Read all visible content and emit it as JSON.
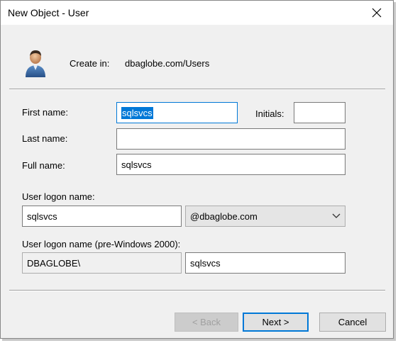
{
  "window": {
    "title": "New Object - User"
  },
  "icons": {
    "close": "close-icon",
    "user": "user-icon",
    "dropdown": "chevron-down-icon"
  },
  "header": {
    "create_in_label": "Create in:",
    "create_in_value": "dbaglobe.com/Users"
  },
  "form": {
    "first_name_label": "First name:",
    "first_name_value": "sqlsvcs",
    "initials_label": "Initials:",
    "initials_value": "",
    "last_name_label": "Last name:",
    "last_name_value": "",
    "full_name_label": "Full name:",
    "full_name_value": "sqlsvcs",
    "logon_label": "User logon name:",
    "logon_value": "sqlsvcs",
    "domain_suffix": "@dbaglobe.com",
    "pre2000_label": "User logon name (pre-Windows 2000):",
    "pre2000_domain": "DBAGLOBE\\",
    "pre2000_value": "sqlsvcs"
  },
  "buttons": {
    "back": "< Back",
    "next": "Next >",
    "cancel": "Cancel"
  },
  "colors": {
    "selection": "#0078d7",
    "dialog_bg": "#f0f0f0"
  }
}
